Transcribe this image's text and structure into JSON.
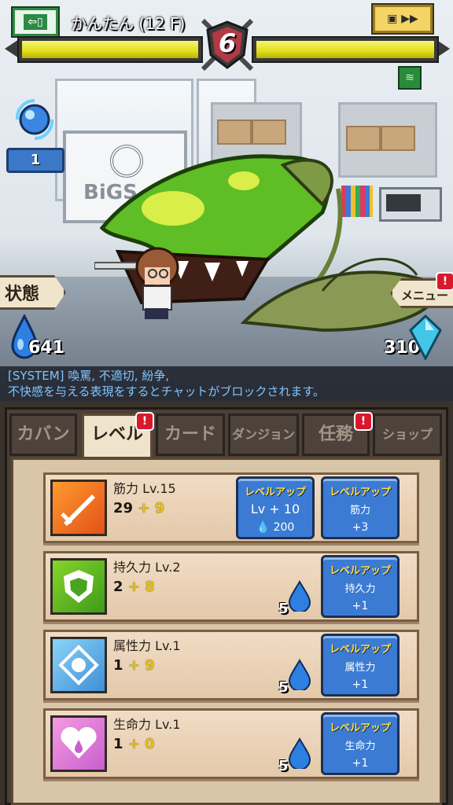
{
  "header": {
    "exit_icon": "exit-door-icon",
    "stage_title": "かんたん (12 F)",
    "turn_number": "6",
    "speed_icon": "fast-forward-icon",
    "player_hp_fraction": 1.0,
    "enemy_hp_fraction": 1.0
  },
  "hud": {
    "orb_count": "1",
    "status_label": "状態",
    "menu_label": "メニュー",
    "menu_alert": "!",
    "water_drops": "641",
    "gems": "310",
    "buff_icon": "wave-buff-icon"
  },
  "scene": {
    "sign_text": "BiGS"
  },
  "chat": {
    "line1": "[SYSTEM] 喚罵, 不適切, 紛争,",
    "line2": "不快感を与える表現をするとチャットがブロックされます。"
  },
  "tabs": [
    {
      "label": "カバン",
      "active": false
    },
    {
      "label": "レベル",
      "active": true,
      "alert": "!"
    },
    {
      "label": "カード",
      "active": false
    },
    {
      "label": "ダンジョン",
      "active": false
    },
    {
      "label": "任務",
      "active": false,
      "alert": "!"
    },
    {
      "label": "ショップ",
      "active": false
    }
  ],
  "stats": [
    {
      "name": "筋力 Lv.15",
      "base": "29",
      "bonus": "+ 9",
      "icon": "sword-icon",
      "btn_lv": {
        "title": "レベルアップ",
        "line": "Lv + 10",
        "cost": "200"
      },
      "btn": {
        "title": "レベルアップ",
        "stat": "筋力",
        "amount": "+3"
      }
    },
    {
      "name": "持久力 Lv.2",
      "base": "2",
      "bonus": "+ 8",
      "icon": "shield-icon",
      "cost": "5",
      "btn": {
        "title": "レベルアップ",
        "stat": "持久力",
        "amount": "+1"
      }
    },
    {
      "name": "属性力 Lv.1",
      "base": "1",
      "bonus": "+ 9",
      "icon": "element-crystal-icon",
      "cost": "5",
      "btn": {
        "title": "レベルアップ",
        "stat": "属性力",
        "amount": "+1"
      }
    },
    {
      "name": "生命力 Lv.1",
      "base": "1",
      "bonus": "+ 0",
      "icon": "heart-icon",
      "cost": "5",
      "btn": {
        "title": "レベルアップ",
        "stat": "生命力",
        "amount": "+1"
      }
    }
  ],
  "colors": {
    "hp_yellow": "#e1de18",
    "button_blue": "#3c7bd3",
    "bonus_yellow": "#e6c30f",
    "alert_red": "#d8192b"
  }
}
